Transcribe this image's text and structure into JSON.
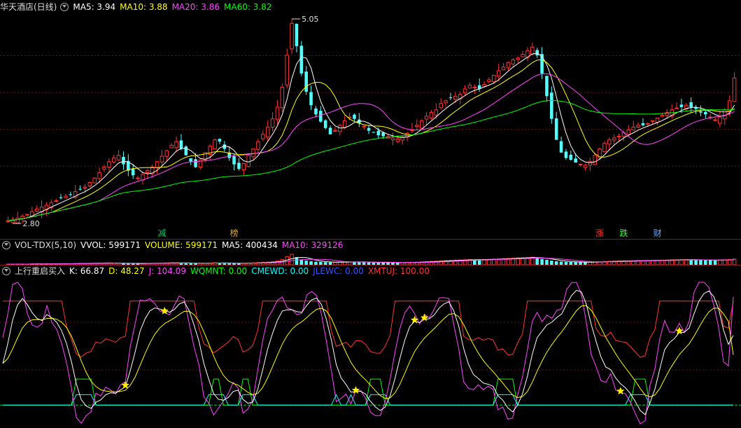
{
  "main_panel": {
    "title": "华天酒店(日线)",
    "legend": [
      {
        "label": "MA5: 3.94",
        "color": "#ffffff"
      },
      {
        "label": "MA10: 3.88",
        "color": "#ffff00"
      },
      {
        "label": "MA20: 3.86",
        "color": "#ff44ff"
      },
      {
        "label": "MA60: 3.82",
        "color": "#00ff00"
      }
    ],
    "high_label": "5.05",
    "low_label": "2.80",
    "events": [
      {
        "text": "减",
        "color": "#00cc66"
      },
      {
        "text": "榜",
        "color": "#ddaa33"
      },
      {
        "text": "涨",
        "color": "#ff3333"
      },
      {
        "text": "跌",
        "color": "#33ff33"
      },
      {
        "text": "财",
        "color": "#66aaff"
      }
    ]
  },
  "volume_panel": {
    "name": "VOL-TDX(5,10)",
    "legend": [
      {
        "label": "VVOL: 599171",
        "color": "#ffffff"
      },
      {
        "label": "VOLUME: 599171",
        "color": "#ffff00"
      },
      {
        "label": "MA5: 400434",
        "color": "#ffffff"
      },
      {
        "label": "MA10: 329126",
        "color": "#ff44ff"
      }
    ]
  },
  "indicator_panel": {
    "name": "上行重启买入",
    "legend": [
      {
        "label": "K: 66.87",
        "color": "#ffffff"
      },
      {
        "label": "D: 48.27",
        "color": "#ffff00"
      },
      {
        "label": "J: 104.09",
        "color": "#ff44ff"
      },
      {
        "label": "WQMNT: 0.00",
        "color": "#00ff00"
      },
      {
        "label": "CMEWD: 0.00",
        "color": "#00ffff"
      },
      {
        "label": "JLEWC: 0.00",
        "color": "#3355ff"
      },
      {
        "label": "XMTUJ: 100.00",
        "color": "#ff3333"
      }
    ]
  },
  "chart_data": [
    {
      "type": "candlestick",
      "title": "华天酒店(日线)",
      "ylim": [
        2.8,
        5.05
      ],
      "series": [
        {
          "name": "MA5",
          "color": "#ffffff"
        },
        {
          "name": "MA10",
          "color": "#ffff00"
        },
        {
          "name": "MA20",
          "color": "#ff44ff"
        },
        {
          "name": "MA60",
          "color": "#00ff00"
        }
      ],
      "closes": [
        2.83,
        2.84,
        2.86,
        2.88,
        2.9,
        2.93,
        2.96,
        2.98,
        3.0,
        3.03,
        3.05,
        3.08,
        3.1,
        3.12,
        3.15,
        3.18,
        3.2,
        3.25,
        3.3,
        3.36,
        3.42,
        3.48,
        3.52,
        3.55,
        3.45,
        3.38,
        3.33,
        3.3,
        3.34,
        3.38,
        3.42,
        3.48,
        3.54,
        3.6,
        3.66,
        3.7,
        3.62,
        3.55,
        3.48,
        3.42,
        3.5,
        3.58,
        3.65,
        3.72,
        3.7,
        3.62,
        3.52,
        3.45,
        3.4,
        3.46,
        3.55,
        3.62,
        3.7,
        3.78,
        3.86,
        3.95,
        4.08,
        4.3,
        4.65,
        5.0,
        4.75,
        4.45,
        4.25,
        4.1,
        4.0,
        3.92,
        3.85,
        3.78,
        3.82,
        3.88,
        3.93,
        3.97,
        3.95,
        3.9,
        3.87,
        3.82,
        3.8,
        3.77,
        3.76,
        3.75,
        3.74,
        3.73,
        3.75,
        3.79,
        3.83,
        3.88,
        3.93,
        3.98,
        4.02,
        4.05,
        4.12,
        4.15,
        4.18,
        4.2,
        4.22,
        4.28,
        4.32,
        4.3,
        4.28,
        4.33,
        4.38,
        4.43,
        4.48,
        4.52,
        4.57,
        4.6,
        4.62,
        4.66,
        4.7,
        4.74,
        4.65,
        4.45,
        4.2,
        3.95,
        3.72,
        3.58,
        3.52,
        3.5,
        3.47,
        3.45,
        3.44,
        3.48,
        3.55,
        3.62,
        3.68,
        3.72,
        3.74,
        3.76,
        3.8,
        3.83,
        3.86,
        3.88,
        3.88,
        3.9,
        3.93,
        3.96,
        3.99,
        4.02,
        4.05,
        4.07,
        4.08,
        4.1,
        4.08,
        4.06,
        4.02,
        4.0,
        3.97,
        3.94,
        3.97,
        4.05,
        4.15,
        4.4
      ]
    },
    {
      "type": "bar",
      "title": "VOL-TDX(5,10)",
      "series": [
        {
          "name": "VVOL",
          "color": "#ffffff"
        },
        {
          "name": "VOLUME",
          "color": "#ffff00"
        },
        {
          "name": "MA5",
          "color": "#ffffff"
        },
        {
          "name": "MA10",
          "color": "#ff44ff"
        }
      ],
      "values": [
        120,
        110,
        130,
        140,
        120,
        150,
        160,
        140,
        170,
        180,
        160,
        190,
        200,
        180,
        210,
        230,
        220,
        260,
        280,
        300,
        310,
        330,
        300,
        280,
        240,
        220,
        210,
        200,
        230,
        250,
        270,
        290,
        310,
        330,
        350,
        340,
        300,
        280,
        260,
        240,
        270,
        300,
        320,
        350,
        330,
        300,
        270,
        250,
        240,
        280,
        320,
        350,
        380,
        420,
        460,
        520,
        650,
        900,
        1400,
        1800,
        1300,
        900,
        700,
        600,
        520,
        480,
        450,
        420,
        440,
        470,
        500,
        520,
        500,
        470,
        440,
        420,
        400,
        390,
        380,
        370,
        360,
        350,
        370,
        400,
        430,
        460,
        500,
        540,
        580,
        620,
        680,
        720,
        760,
        800,
        820,
        860,
        900,
        880,
        860,
        900,
        940,
        980,
        1020,
        1060,
        1100,
        1140,
        1180,
        1220,
        1260,
        1300,
        1200,
        1000,
        850,
        700,
        600,
        540,
        500,
        480,
        460,
        440,
        430,
        460,
        500,
        540,
        580,
        600,
        620,
        640,
        660,
        680,
        700,
        720,
        720,
        740,
        760,
        780,
        800,
        820,
        840,
        860,
        870,
        880,
        860,
        840,
        820,
        800,
        780,
        760,
        800,
        860,
        920,
        1000
      ]
    },
    {
      "type": "line",
      "title": "上行重启买入",
      "ylim": [
        -20,
        120
      ],
      "series": [
        {
          "name": "K",
          "color": "#ffffff",
          "last": 66.87
        },
        {
          "name": "D",
          "color": "#ffff00",
          "last": 48.27
        },
        {
          "name": "J",
          "color": "#ff44ff",
          "last": 104.09
        },
        {
          "name": "WQMNT",
          "color": "#00ff00",
          "last": 0.0
        },
        {
          "name": "CMEWD",
          "color": "#00ffff",
          "last": 0.0
        },
        {
          "name": "JLEWC",
          "color": "#3355ff",
          "last": 0.0
        },
        {
          "name": "XMTUJ",
          "color": "#ff3333",
          "last": 100.0
        }
      ]
    }
  ]
}
